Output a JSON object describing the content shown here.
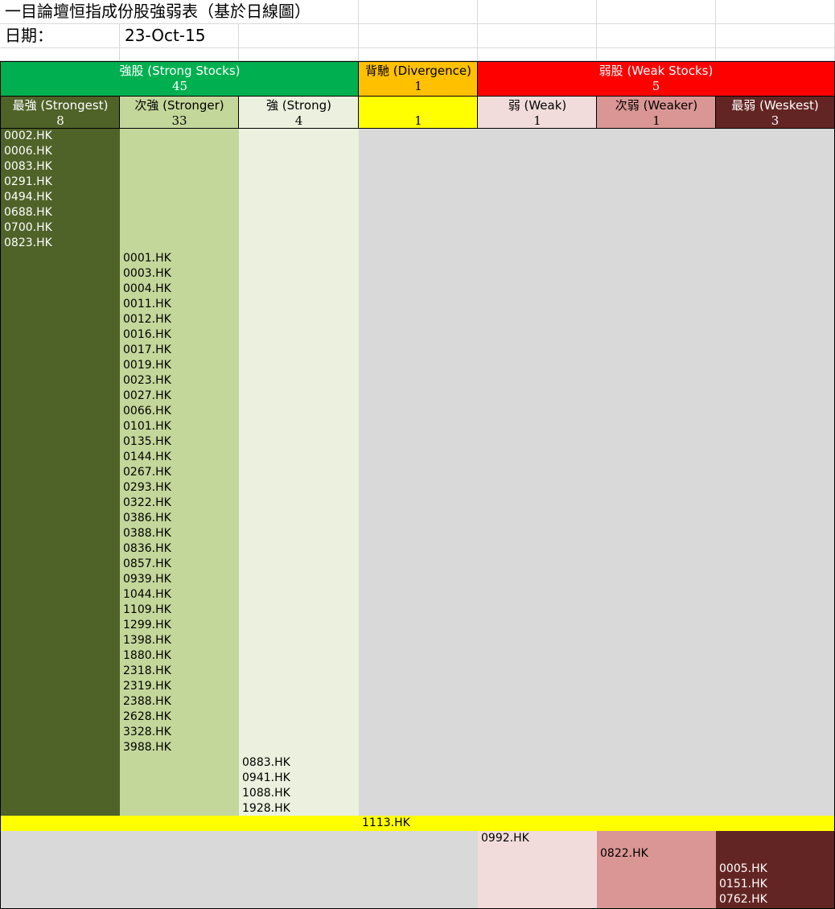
{
  "title": "一目論壇恒指成份股強弱表（基於日線圖）",
  "date_label": "日期：",
  "date_value": "23-Oct-15",
  "groups": {
    "strong": {
      "label": "強股 (Strong Stocks)",
      "count": "45",
      "color": "#00b050"
    },
    "divergence": {
      "label": "背馳 (Divergence)",
      "count": "1",
      "color": "#ffc000"
    },
    "weak": {
      "label": "弱股 (Weak Stocks)",
      "count": "5",
      "color": "#ff0000"
    }
  },
  "subheaders": [
    {
      "label": "最強 (Strongest)",
      "count": "8"
    },
    {
      "label": "次強 (Stronger)",
      "count": "33"
    },
    {
      "label": "強 (Strong)",
      "count": "4"
    },
    {
      "label": "",
      "count": "1"
    },
    {
      "label": "弱 (Weak)",
      "count": "1"
    },
    {
      "label": "次弱 (Weaker)",
      "count": "1"
    },
    {
      "label": "最弱 (Weskest)",
      "count": "3"
    }
  ],
  "colors": {
    "strongest": "#4f6228",
    "stronger": "#c4d79b",
    "strong": "#ebf1de",
    "divergence_sub": "#ffff00",
    "weak": "#f2dcdb",
    "weaker": "#da9694",
    "weakest": "#632523",
    "empty": "#d9d9d9"
  },
  "lists": {
    "strongest": [
      "0002.HK",
      "0006.HK",
      "0083.HK",
      "0291.HK",
      "0494.HK",
      "0688.HK",
      "0700.HK",
      "0823.HK"
    ],
    "stronger": [
      "0001.HK",
      "0003.HK",
      "0004.HK",
      "0011.HK",
      "0012.HK",
      "0016.HK",
      "0017.HK",
      "0019.HK",
      "0023.HK",
      "0027.HK",
      "0066.HK",
      "0101.HK",
      "0135.HK",
      "0144.HK",
      "0267.HK",
      "0293.HK",
      "0322.HK",
      "0386.HK",
      "0388.HK",
      "0836.HK",
      "0857.HK",
      "0939.HK",
      "1044.HK",
      "1109.HK",
      "1299.HK",
      "1398.HK",
      "1880.HK",
      "2318.HK",
      "2319.HK",
      "2388.HK",
      "2628.HK",
      "3328.HK",
      "3988.HK"
    ],
    "strong": [
      "0883.HK",
      "0941.HK",
      "1088.HK",
      "1928.HK"
    ],
    "divergence": [
      "1113.HK"
    ],
    "weak": [
      "0992.HK"
    ],
    "weaker": [
      "0822.HK"
    ],
    "weakest": [
      "0005.HK",
      "0151.HK",
      "0762.HK"
    ]
  }
}
